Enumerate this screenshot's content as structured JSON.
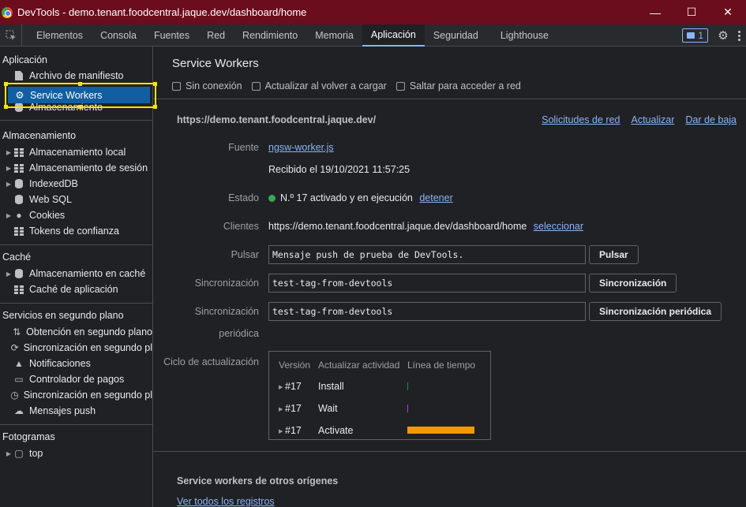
{
  "window": {
    "title": "DevTools - demo.tenant.foodcentral.jaque.dev/dashboard/home",
    "minimize": "—",
    "maximize": "☐",
    "close": "✕"
  },
  "tabs": [
    "Elementos",
    "Consola",
    "Fuentes",
    "Red",
    "Rendimiento",
    "Memoria",
    "Aplicación",
    "Seguridad",
    "Lighthouse"
  ],
  "active_tab": "Aplicación",
  "issues_count": "1",
  "sidebar": {
    "app": {
      "title": "Aplicación",
      "items": [
        "Archivo de manifiesto",
        "Service Workers",
        "Almacenamiento"
      ]
    },
    "storage": {
      "title": "Almacenamiento",
      "items": [
        "Almacenamiento local",
        "Almacenamiento de sesión",
        "IndexedDB",
        "Web SQL",
        "Cookies",
        "Tokens de confianza"
      ]
    },
    "cache": {
      "title": "Caché",
      "items": [
        "Almacenamiento en caché",
        "Caché de aplicación"
      ]
    },
    "background": {
      "title": "Servicios en segundo plano",
      "items": [
        "Obtención en segundo plano",
        "Sincronización en segundo pl",
        "Notificaciones",
        "Controlador de pagos",
        "Sincronización en segundo pl",
        "Mensajes push"
      ]
    },
    "frames": {
      "title": "Fotogramas",
      "items": [
        "top"
      ]
    }
  },
  "main": {
    "title": "Service Workers",
    "options": [
      "Sin conexión",
      "Actualizar al volver a cargar",
      "Saltar para acceder a red"
    ],
    "scope_url": "https://demo.tenant.foodcentral.jaque.dev/",
    "scope_links": [
      "Solicitudes de red",
      "Actualizar",
      "Dar de baja"
    ],
    "source_label": "Fuente",
    "source_file": "ngsw-worker.js",
    "received": "Recibido el 19/10/2021 11:57:25",
    "status_label": "Estado",
    "status_text": "N.º 17 activado y en ejecución",
    "status_action": "detener",
    "clients_label": "Clientes",
    "clients_url": "https://demo.tenant.foodcentral.jaque.dev/dashboard/home",
    "clients_action": "seleccionar",
    "push_label": "Pulsar",
    "push_value": "Mensaje push de prueba de DevTools.",
    "push_button": "Pulsar",
    "sync_label": "Sincronización",
    "sync_value": "test-tag-from-devtools",
    "sync_button": "Sincronización",
    "periodic_label_1": "Sincronización",
    "periodic_label_2": "periódica",
    "periodic_value": "test-tag-from-devtools",
    "periodic_button": "Sincronización periódica",
    "cycle_label": "Ciclo de actualización",
    "cycle_headers": [
      "Versión",
      "Actualizar actividad",
      "Línea de tiempo"
    ],
    "cycle_rows": [
      {
        "version": "#17",
        "activity": "Install",
        "timeline_color": "#1e8e3e"
      },
      {
        "version": "#17",
        "activity": "Wait",
        "timeline_color": "#a142f4"
      },
      {
        "version": "#17",
        "activity": "Activate",
        "timeline_color": "#f29900"
      }
    ],
    "other_origins_title": "Service workers de otros orígenes",
    "all_records_link": "Ver todos los registros"
  }
}
